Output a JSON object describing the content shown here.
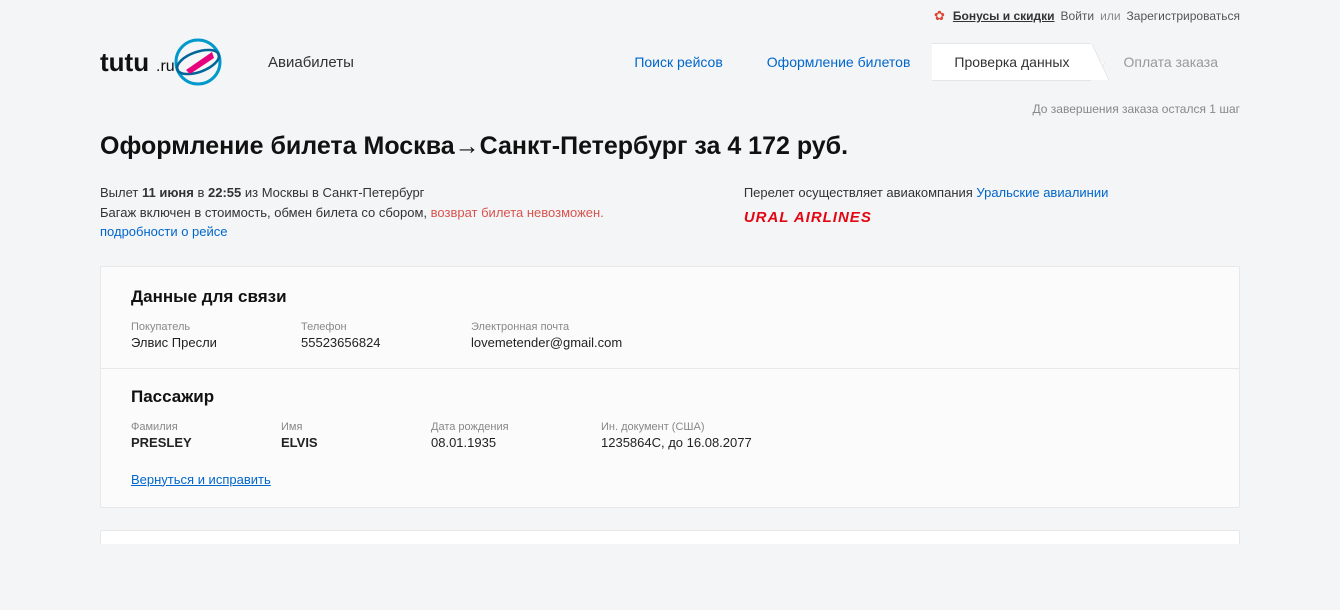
{
  "topnav": {
    "bonus": "Бонусы и скидки",
    "login": "Войти",
    "or": "или",
    "register": "Зарегистрироваться"
  },
  "header": {
    "section": "Авиабилеты"
  },
  "wizard": {
    "steps": [
      "Поиск рейсов",
      "Оформление билетов",
      "Проверка данных",
      "Оплата заказа"
    ],
    "remaining": "До завершения заказа остался 1 шаг"
  },
  "title": {
    "prefix": "Оформление билета ",
    "from": "Москва",
    "to": "Санкт-Петербург",
    "suffix": " за 4 172 руб."
  },
  "flight": {
    "departure_prefix": "Вылет ",
    "date": "11 июня",
    "at": " в ",
    "time": "22:55",
    "route_suffix": " из Москвы в Санкт-Петербург",
    "baggage": "Багаж включен в стоимость, обмен билета со сбором, ",
    "noreturn": "возврат билета невозможен.",
    "details_link": "подробности о рейсе",
    "operated_by": "Перелет осуществляет авиакомпания ",
    "airline_link": "Уральские авиалинии",
    "airline_logo": "URAL AIRLINES"
  },
  "contact": {
    "heading": "Данные для связи",
    "buyer_label": "Покупатель",
    "buyer": "Элвис Пресли",
    "phone_label": "Телефон",
    "phone": "55523656824",
    "email_label": "Электронная почта",
    "email": "lovemetender@gmail.com"
  },
  "passenger": {
    "heading": "Пассажир",
    "surname_label": "Фамилия",
    "surname": "PRESLEY",
    "name_label": "Имя",
    "name": "ELVIS",
    "dob_label": "Дата рождения",
    "dob": "08.01.1935",
    "doc_label": "Ин. документ (США)",
    "doc": "1235864С, до 16.08.2077"
  },
  "back_link": "Вернуться и исправить"
}
